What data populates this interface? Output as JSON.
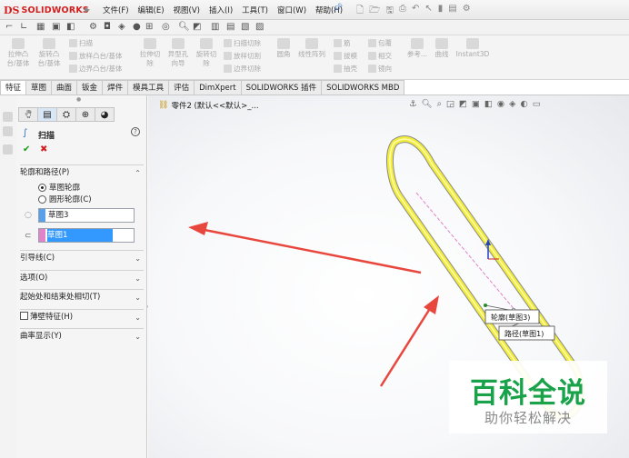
{
  "app": {
    "logo_prefix": "DS",
    "logo_text": "SOLIDWORKS",
    "menus": [
      "文件(F)",
      "编辑(E)",
      "视图(V)",
      "插入(I)",
      "工具(T)",
      "窗口(W)",
      "帮助(H)"
    ]
  },
  "command_manager": {
    "features": [
      {
        "label1": "拉伸凸",
        "label2": "台/基体"
      },
      {
        "label1": "旋转凸",
        "label2": "台/基体"
      }
    ],
    "sweep_group": [
      "扫描",
      "放样凸台/基体",
      "边界凸台/基体"
    ],
    "cut_features": [
      {
        "label1": "拉伸切",
        "label2": "除"
      },
      {
        "label1": "异型孔",
        "label2": "向导"
      },
      {
        "label1": "旋转切",
        "label2": "除"
      }
    ],
    "cut_group": [
      "扫描切除",
      "放样切割",
      "边界切除"
    ],
    "fillet": "圆角",
    "pattern": "线性阵列",
    "rib_group": [
      "筋",
      "拔模",
      "抽壳"
    ],
    "wrap_group": [
      "包覆",
      "相交",
      "镜向"
    ],
    "reference": "参考...",
    "curves": "曲线",
    "instant3d": "Instant3D"
  },
  "tabs": [
    "特征",
    "草图",
    "曲面",
    "钣金",
    "焊件",
    "模具工具",
    "评估",
    "DimXpert",
    "SOLIDWORKS 插件",
    "SOLIDWORKS MBD"
  ],
  "property_manager": {
    "title": "扫描",
    "help": "?",
    "profile_section": {
      "title": "轮廓和路径(P)",
      "options": [
        "草图轮廓",
        "圆形轮廓(C)"
      ],
      "selected_option": 0,
      "profile_value": "草图3",
      "path_value": "草图1"
    },
    "collapsed_sections": [
      "引导线(C)",
      "选项(O)",
      "起始处和结束处相切(T)",
      "薄壁特征(H)",
      "曲率显示(Y)"
    ]
  },
  "viewport": {
    "breadcrumb": "零件2 (默认<<默认>_..."
  },
  "callouts": {
    "profile": "轮廓(草图3)",
    "path": "路径(草图1)"
  },
  "watermark": {
    "title": "百科全说",
    "subtitle": "助你轻松解决"
  },
  "colors": {
    "accent_red": "#d21f1f",
    "selection_blue": "#3399ff",
    "profile_swatch": "#5aa0e8",
    "path_swatch": "#e083c8",
    "preview_yellow": "#f2ec3c",
    "arrow_red": "#e8473e",
    "watermark_green": "#19a24a"
  }
}
